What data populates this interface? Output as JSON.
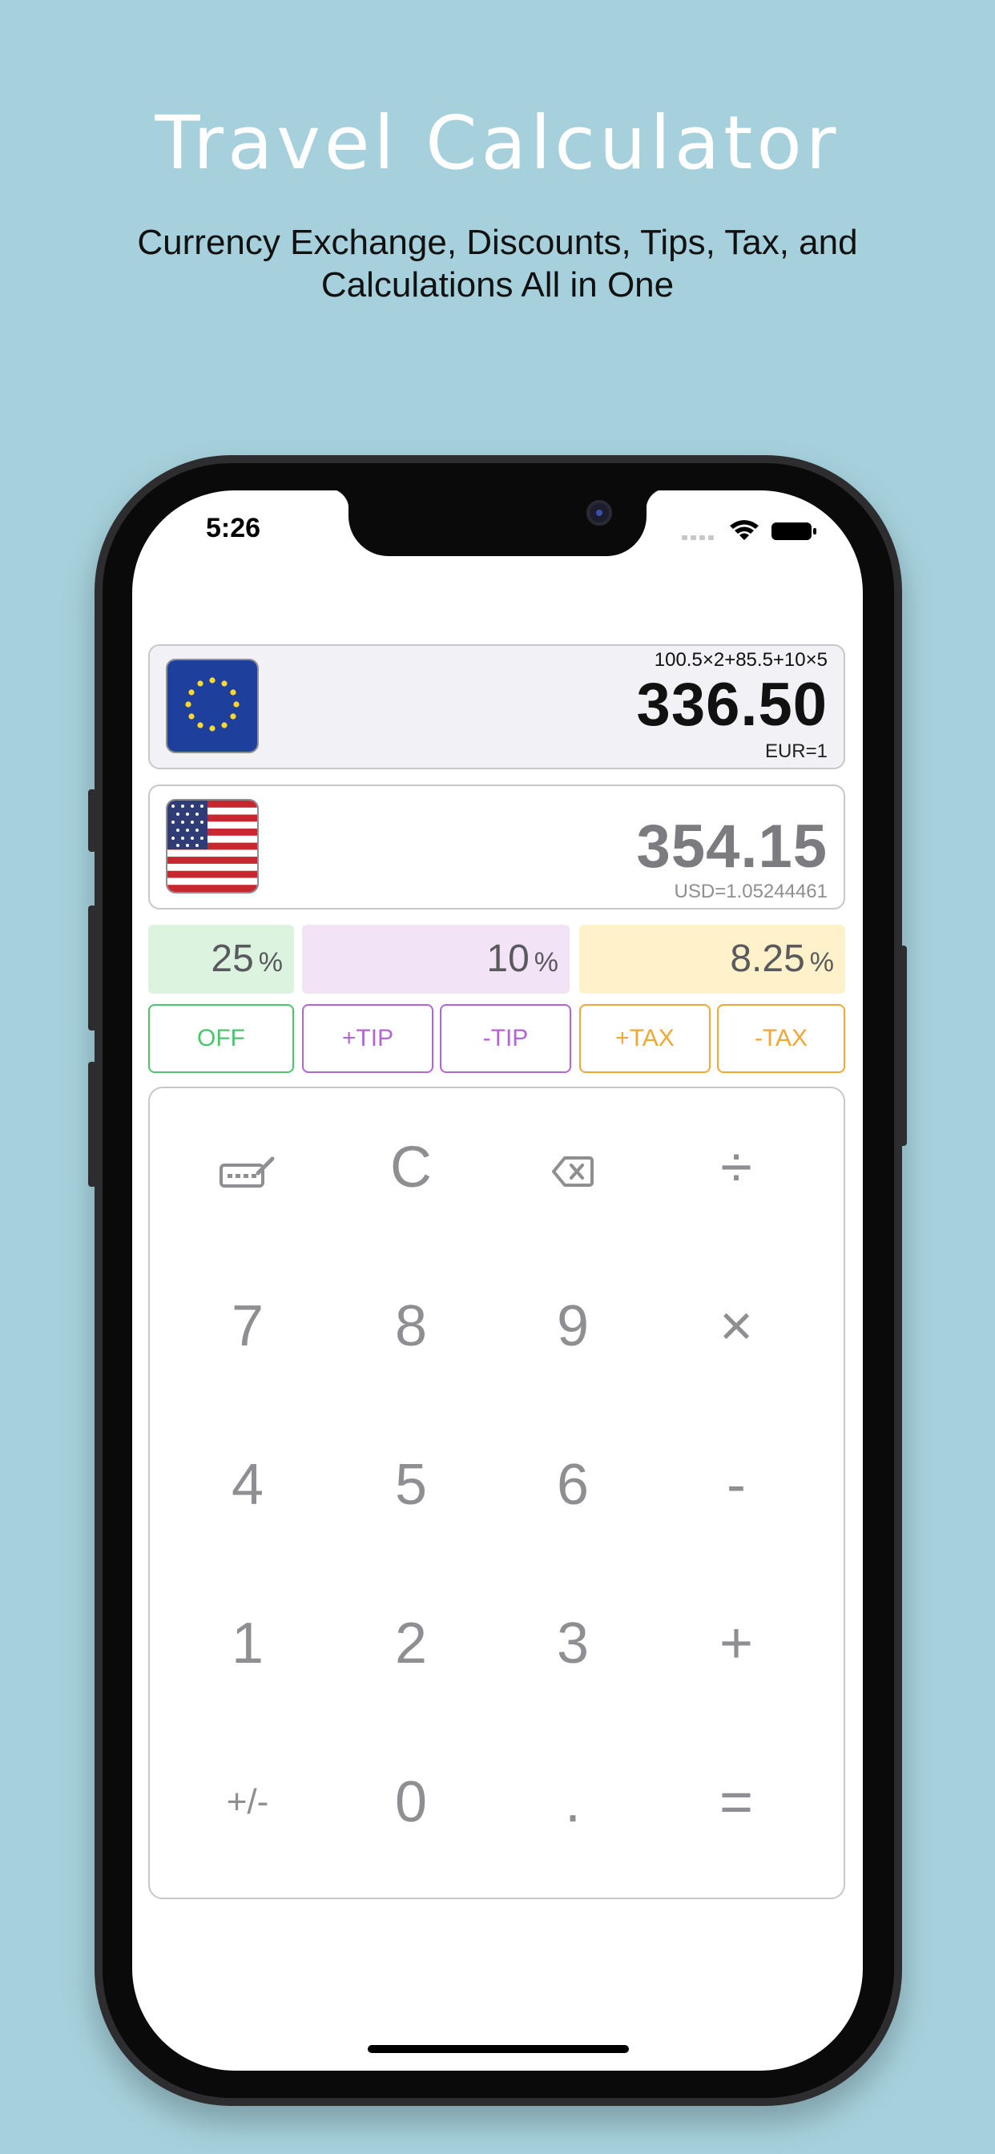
{
  "hero": {
    "title": "Travel Calculator",
    "subtitle": "Currency Exchange, Discounts, Tips, Tax, and Calculations All in One"
  },
  "status_bar": {
    "time": "5:26",
    "icons": [
      "signal-icon",
      "wifi-icon",
      "battery-icon"
    ]
  },
  "source_currency": {
    "flag": "eu-flag",
    "expression": "100.5×2+85.5+10×5",
    "amount": "336.50",
    "rate": "EUR=1"
  },
  "target_currency": {
    "flag": "us-flag",
    "amount": "354.15",
    "rate": "USD=1.05244461"
  },
  "percentages": {
    "discount": "25",
    "tip": "10",
    "tax": "8.25",
    "unit": "%"
  },
  "actions": {
    "off": "OFF",
    "tip_plus": "+TIP",
    "tip_minus": "-TIP",
    "tax_plus": "+TAX",
    "tax_minus": "-TAX"
  },
  "keypad": {
    "row1": [
      "keyboard-icon",
      "C",
      "backspace-icon",
      "÷"
    ],
    "row2": [
      "7",
      "8",
      "9",
      "×"
    ],
    "row3": [
      "4",
      "5",
      "6",
      "-"
    ],
    "row4": [
      "1",
      "2",
      "3",
      "+"
    ],
    "row5": [
      "+/-",
      "0",
      ".",
      "="
    ]
  },
  "colors": {
    "background": "#a6d1dc",
    "discount": "#4cc46b",
    "tip": "#b364d6",
    "tax": "#f2a634",
    "key_text": "#8e8e93"
  }
}
